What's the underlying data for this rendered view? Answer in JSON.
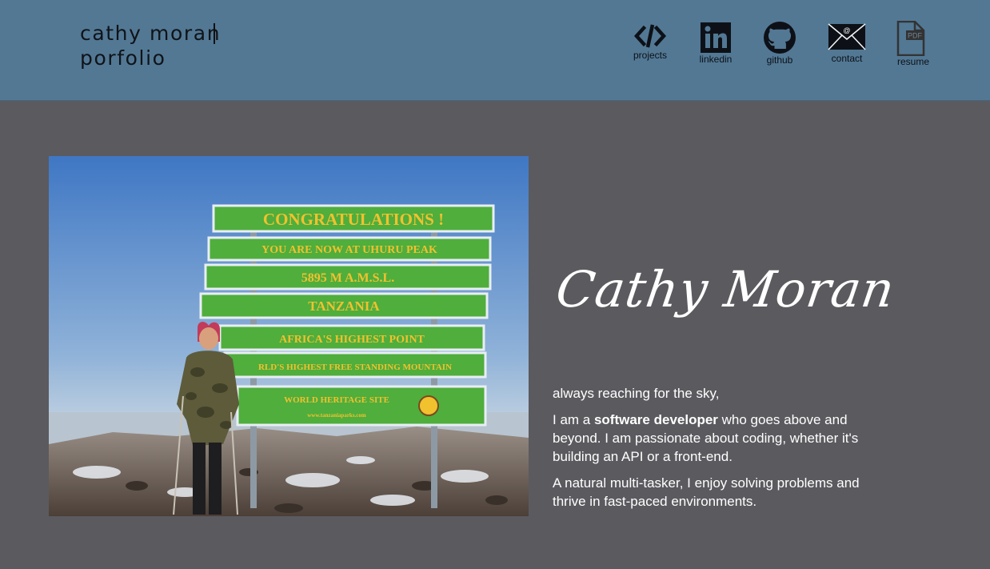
{
  "header": {
    "brand_line1": "cathy moran",
    "brand_line2": "porfolio",
    "nav": [
      {
        "label": "projects",
        "icon": "code-icon"
      },
      {
        "label": "linkedin",
        "icon": "linkedin-icon"
      },
      {
        "label": "github",
        "icon": "github-icon"
      },
      {
        "label": "contact",
        "icon": "envelope-icon"
      },
      {
        "label": "resume",
        "icon": "pdf-icon"
      }
    ]
  },
  "photo": {
    "sign_lines": [
      "CONGRATULATIONS !",
      "YOU ARE NOW AT UHURU PEAK",
      "5895 M A.M.S.L.",
      "TANZANIA",
      "AFRICA'S HIGHEST POINT",
      "RLD'S HIGHEST FREE STANDING MOUNTAIN",
      "WORLD HERITAGE SITE",
      "www.tanzaniaparks.com"
    ]
  },
  "hero": {
    "name": "Cathy Moran",
    "tagline": "always reaching for the sky,",
    "bio_1_prefix": "I am a ",
    "bio_1_bold": "software developer",
    "bio_1_suffix": " who goes above and beyond. I am passionate about coding, whether it's building an API or a front-end.",
    "bio_2": "A natural multi-tasker, I enjoy solving problems and thrive in fast-paced environments."
  },
  "colors": {
    "header_bg": "#527894",
    "page_bg": "#5b5a5f",
    "text_light": "#ffffff",
    "sign_green": "#4fae3c",
    "sign_text": "#f2c12e"
  }
}
